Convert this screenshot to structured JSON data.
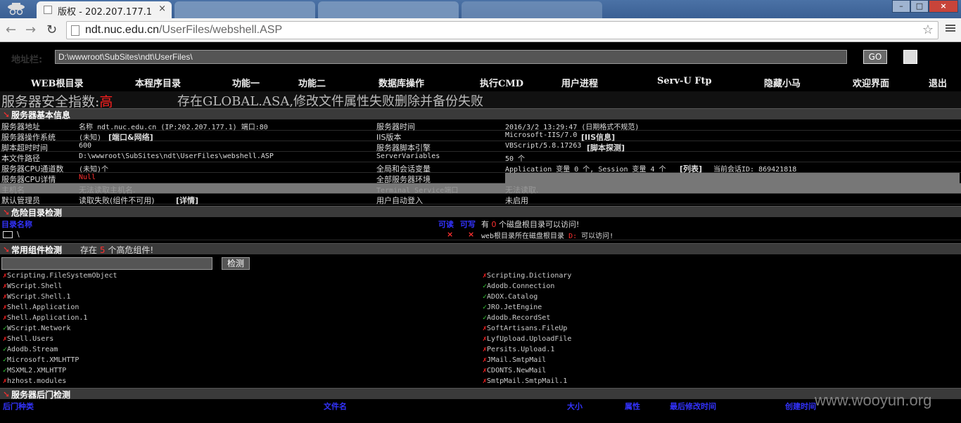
{
  "browser": {
    "tab_active_title": "版权 - 202.207.177.1",
    "tab_close": "×",
    "url_host": "ndt.nuc.edu.cn",
    "url_path": "/UserFiles/webshell.ASP",
    "win_buttons": [
      "–",
      "□",
      "×"
    ]
  },
  "pathbar": {
    "label": "地址栏:",
    "value": "D:\\wwwroot\\SubSites\\ndt\\UserFiles\\",
    "go": "GO"
  },
  "nav": [
    "WEB根目录",
    "本程序目录",
    "功能一",
    "功能二",
    "数据库操作",
    "执行CMD",
    "用户进程",
    "Serv-U Ftp",
    "隐藏小马",
    "欢迎界面",
    "退出"
  ],
  "security": {
    "label": "服务器安全指数:",
    "level": "高",
    "message": "存在GLOBAL.ASA,修改文件属性失败删除并备份失败"
  },
  "basic": {
    "title": "服务器基本信息",
    "rows": [
      {
        "l1": "服务器地址",
        "v1": "名称 ndt.nuc.edu.cn (IP:202.207.177.1) 端口:80",
        "l2": "服务器时间",
        "v2": "2016/3/2 13:29:47 (日期格式不规范)"
      },
      {
        "l1": "服务器操作系统",
        "v1": "(未知)",
        "v1b": "[端口&网络]",
        "l2": "IIS版本",
        "v2": "Microsoft-IIS/7.0",
        "v2b": "[IIS信息]"
      },
      {
        "l1": "脚本超时时间",
        "v1": "600",
        "l2": "服务器脚本引擎",
        "v2": "VBScript/5.8.17263",
        "v2b": "[脚本探测]"
      },
      {
        "l1": "本文件路径",
        "v1": "D:\\wwwroot\\SubSites\\ndt\\UserFiles\\webshell.ASP",
        "l2": "ServerVariables",
        "v2": "50 个"
      },
      {
        "l1": "服务器CPU通道数",
        "v1": "(未知)个",
        "l2": "全局和会话变量",
        "v2": "Application 变量 0 个, Session 变量 4 个",
        "v2b": "[列表]",
        "v2c": "当前会话ID: 869421818"
      },
      {
        "l1": "服务器CPU详情",
        "v1": "Null",
        "l2": "全部服务器环境",
        "v2": ""
      },
      {
        "l1": "主机名",
        "v1": "无法读取主机名.",
        "l2": "Terminal Service端口",
        "v2": "无法读取."
      },
      {
        "l1": "默认管理员",
        "v1": "读取失败(组件不可用)",
        "v1b": "[详情]",
        "l2": "用户自动登入",
        "v2": "未启用"
      }
    ]
  },
  "danger": {
    "title": "危险目录检测",
    "col_name": "目录名称",
    "col_read": "可读",
    "col_write": "可写",
    "info1a": "有",
    "info1n": "0",
    "info1b": "个磁盘根目录可以访问!",
    "dir": "\\",
    "cross": "×",
    "info2a": "web根目录所在磁盘根目录",
    "info2d": "D:",
    "info2b": "可以访问!"
  },
  "components": {
    "title": "常用组件检测",
    "count_pre": "存在",
    "count": "5",
    "count_post": "个高危组件!",
    "detect": "检测",
    "left": [
      {
        "name": "Scripting.FileSystemObject",
        "ok": false
      },
      {
        "name": "WScript.Shell",
        "ok": false
      },
      {
        "name": "WScript.Shell.1",
        "ok": false
      },
      {
        "name": "Shell.Application",
        "ok": false
      },
      {
        "name": "Shell.Application.1",
        "ok": false
      },
      {
        "name": "WScript.Network",
        "ok": true
      },
      {
        "name": "Shell.Users",
        "ok": false
      },
      {
        "name": "Adodb.Stream",
        "ok": true
      },
      {
        "name": "Microsoft.XMLHTTP",
        "ok": true
      },
      {
        "name": "MSXML2.XMLHTTP",
        "ok": true
      },
      {
        "name": "hzhost.modules",
        "ok": false
      }
    ],
    "right": [
      {
        "name": "Scripting.Dictionary",
        "ok": false
      },
      {
        "name": "Adodb.Connection",
        "ok": true
      },
      {
        "name": "ADOX.Catalog",
        "ok": true
      },
      {
        "name": "JRO.JetEngine",
        "ok": true
      },
      {
        "name": "Adodb.RecordSet",
        "ok": true
      },
      {
        "name": "SoftArtisans.FileUp",
        "ok": false
      },
      {
        "name": "LyfUpload.UploadFile",
        "ok": false
      },
      {
        "name": "Persits.Upload.1",
        "ok": false
      },
      {
        "name": "JMail.SmtpMail",
        "ok": false
      },
      {
        "name": "CDONTS.NewMail",
        "ok": false
      },
      {
        "name": "SmtpMail.SmtpMail.1",
        "ok": false
      }
    ],
    "ok_mark": "✓",
    "no_mark": "✗"
  },
  "backdoor": {
    "title": "服务器后门检测",
    "cols": [
      "后门种类",
      "文件名",
      "大小",
      "属性",
      "最后修改时间",
      "创建时间"
    ]
  },
  "watermark": "www.wooyun.org",
  "colors": {
    "danger": "#ff3030",
    "ok": "#33cc33",
    "link": "#3333ff"
  }
}
